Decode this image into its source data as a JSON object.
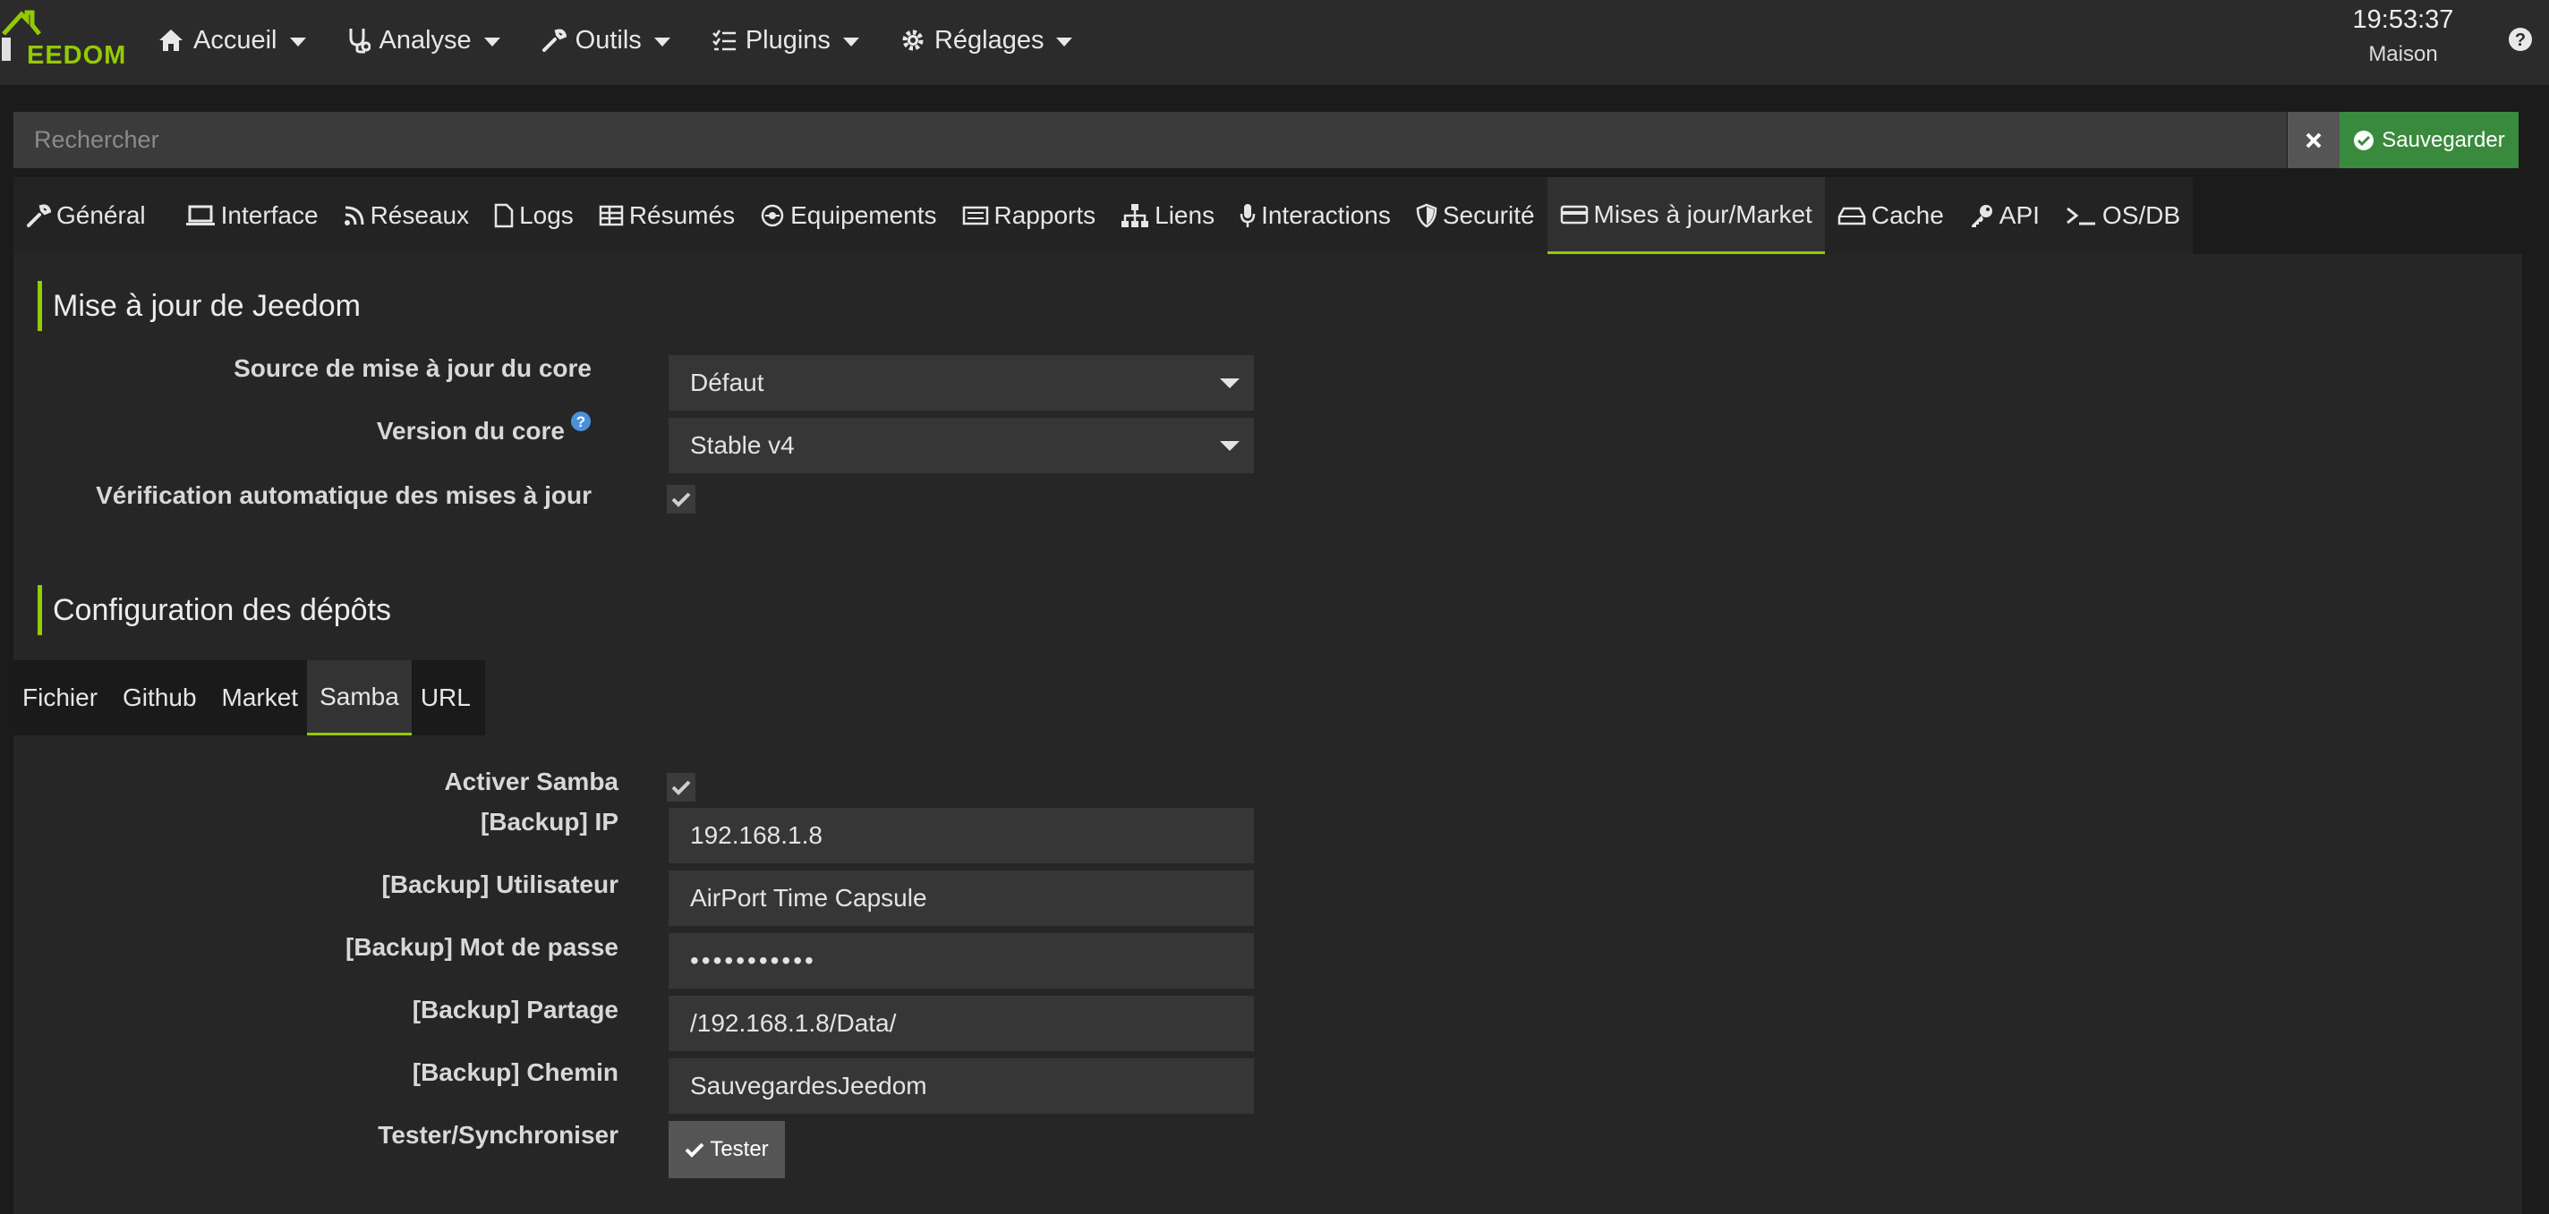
{
  "brand": {
    "logo_text": "EEDOM"
  },
  "nav": {
    "items": [
      {
        "label": "Accueil",
        "icon": "home-icon"
      },
      {
        "label": "Analyse",
        "icon": "stethoscope-icon"
      },
      {
        "label": "Outils",
        "icon": "wrench-icon"
      },
      {
        "label": "Plugins",
        "icon": "tasks-icon"
      },
      {
        "label": "Réglages",
        "icon": "gear-icon"
      }
    ],
    "time": "19:53:37",
    "location": "Maison"
  },
  "search": {
    "placeholder": "Rechercher",
    "value": ""
  },
  "actions": {
    "save_label": "Sauvegarder"
  },
  "tabs": [
    {
      "label": "Général",
      "icon": "wrench-icon"
    },
    {
      "label": "Interface",
      "icon": "laptop-icon"
    },
    {
      "label": "Réseaux",
      "icon": "rss-icon"
    },
    {
      "label": "Logs",
      "icon": "file-icon"
    },
    {
      "label": "Résumés",
      "icon": "table-icon"
    },
    {
      "label": "Equipements",
      "icon": "equipment-icon"
    },
    {
      "label": "Rapports",
      "icon": "report-icon"
    },
    {
      "label": "Liens",
      "icon": "sitemap-icon"
    },
    {
      "label": "Interactions",
      "icon": "microphone-icon"
    },
    {
      "label": "Securité",
      "icon": "shield-icon"
    },
    {
      "label": "Mises à jour/Market",
      "icon": "credit-card-icon",
      "active": true
    },
    {
      "label": "Cache",
      "icon": "hdd-icon"
    },
    {
      "label": "API",
      "icon": "key-icon"
    },
    {
      "label": "OS/DB",
      "icon": "terminal-icon"
    }
  ],
  "update_section": {
    "title": "Mise à jour de Jeedom",
    "source_label": "Source de mise à jour du core",
    "source_value": "Défaut",
    "version_label": "Version du core",
    "version_value": "Stable v4",
    "auto_check_label": "Vérification automatique des mises à jour",
    "auto_check": true
  },
  "repo_section": {
    "title": "Configuration des dépôts",
    "subtabs": [
      {
        "label": "Fichier"
      },
      {
        "label": "Github"
      },
      {
        "label": "Market"
      },
      {
        "label": "Samba",
        "active": true
      },
      {
        "label": "URL"
      }
    ]
  },
  "samba": {
    "enable_label": "Activer Samba",
    "enabled": true,
    "ip_label": "[Backup] IP",
    "ip_value": "192.168.1.8",
    "user_label": "[Backup] Utilisateur",
    "user_value": "AirPort Time Capsule",
    "password_label": "[Backup] Mot de passe",
    "password_value": "•••••••••••",
    "share_label": "[Backup] Partage",
    "share_value": "/192.168.1.8/Data/",
    "path_label": "[Backup] Chemin",
    "path_value": "SauvegardesJeedom",
    "test_label": "Tester/Synchroniser",
    "test_button": "Tester"
  },
  "colors": {
    "accent": "#94ca02",
    "save": "#3a8a3e",
    "help": "#4a90d9"
  }
}
